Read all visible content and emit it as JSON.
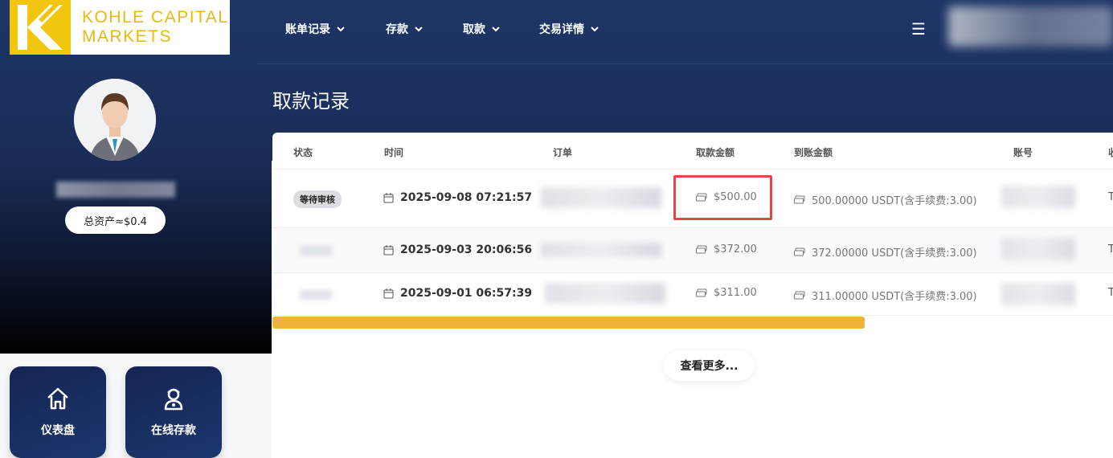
{
  "brand": {
    "line1": "KOHLE CAPITAL",
    "line2": "MARKETS"
  },
  "nav": [
    {
      "label": "账单记录",
      "icon": "chevron-down-icon"
    },
    {
      "label": "存款",
      "icon": "chevron-down-icon"
    },
    {
      "label": "取款",
      "icon": "chevron-down-icon"
    },
    {
      "label": "交易详情",
      "icon": "chevron-down-icon"
    }
  ],
  "menu_icon": "☰",
  "profile": {
    "total_assets": "总资产≈$0.4"
  },
  "tiles": [
    {
      "label": "仪表盘",
      "icon": "home-icon"
    },
    {
      "label": "在线存款",
      "icon": "user-support-icon"
    }
  ],
  "page_title": "取款记录",
  "table": {
    "columns": [
      "状态",
      "时间",
      "订单",
      "取款金额",
      "到账金额",
      "账号",
      "收"
    ],
    "rows": [
      {
        "status": "等待审核",
        "time": "2025-09-08 07:21:57",
        "amount": "$500.00",
        "received": "500.00000 USDT(含手续费:3.00)",
        "extra": "T"
      },
      {
        "status": "",
        "time": "2025-09-03 20:06:56",
        "amount": "$372.00",
        "received": "372.00000 USDT(含手续费:3.00)",
        "extra": "T"
      },
      {
        "status": "",
        "time": "2025-09-01 06:57:39",
        "amount": "$311.00",
        "received": "311.00000 USDT(含手续费:3.00)",
        "extra": "T"
      }
    ]
  },
  "more_button": "查看更多...",
  "colors": {
    "accent": "#f2c511",
    "header_bg": "#1e3566",
    "scrollbar": "#f0b43c",
    "highlight": "#e64545"
  }
}
